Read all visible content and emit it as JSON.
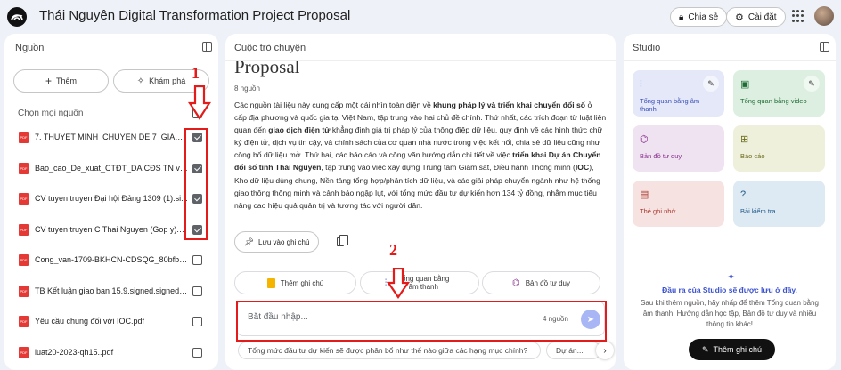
{
  "app": {
    "title": "Thái Nguyên Digital Transformation Project Proposal",
    "share_label": "Chia sẻ",
    "settings_label": "Cài đặt"
  },
  "sources": {
    "title": "Nguồn",
    "add_label": "Thêm",
    "explore_label": "Khám phá",
    "select_all_label": "Chọn mọi nguồn",
    "items": [
      {
        "name": "7. THUYET MINH_CHUYEN DE 7_GIAO DIC...",
        "checked": true
      },
      {
        "name": "Bao_cao_De_xuat_CTĐT_DA CĐS TN v0.1...",
        "checked": true
      },
      {
        "name": "CV tuyen truyen Đại hội Đảng 1309 (1).si...",
        "checked": true
      },
      {
        "name": "CV tuyen truyen C Thai Nguyen (Gop y).p...",
        "checked": true
      },
      {
        "name": "Cong_van-1709-BKHCN-CDSQG_80bfb....",
        "checked": false
      },
      {
        "name": "TB Kết luận giao ban 15.9.signed.signed....",
        "checked": false
      },
      {
        "name": "Yêu cầu chung đối với IOC.pdf",
        "checked": false
      },
      {
        "name": "luat20-2023-qh15..pdf",
        "checked": false
      }
    ],
    "pdf_tag": "PDF"
  },
  "chat": {
    "title": "Cuộc trò chuyện",
    "doc_heading": "Proposal",
    "source_count": "8 nguồn",
    "summary_parts": [
      "Các nguồn tài liệu này cung cấp một cái nhìn toàn diện về ",
      "khung pháp lý và triển khai chuyển đổi số",
      " ở cấp địa phương và quốc gia tại Việt Nam, tập trung vào hai chủ đề chính. Thứ nhất, các trích đoạn từ luật liên quan đến ",
      "giao dịch điện tử",
      " khẳng định giá trị pháp lý của thông điệp dữ liệu, quy định về các hình thức chữ ký điện tử, dịch vụ tin cậy, và chính sách của cơ quan nhà nước trong việc kết nối, chia sẻ dữ liệu cũng như công bố dữ liệu mở. Thứ hai, các báo cáo và công văn hướng dẫn chi tiết về việc ",
      "triển khai Dự án Chuyển đổi số tỉnh Thái Nguyên",
      ", tập trung vào việc xây dựng Trung tâm Giám sát, Điều hành Thông minh (",
      "IOC",
      "), Kho dữ liệu dùng chung, Nền tảng tổng hợp/phân tích dữ liệu, và các giải pháp chuyển ngành như hệ thống giao thông thông minh và cảnh báo ngập lụt, với tổng mức đầu tư dự kiến hơn 134 tỷ đồng, nhằm mục tiêu nâng cao hiệu quả quản trị và tương tác với người dân."
    ],
    "save_note_label": "Lưu vào ghi chú",
    "chips": [
      "Thêm ghi chú",
      "Tổng quan bằng âm thanh",
      "Bản đồ tư duy"
    ],
    "input_placeholder": "Bắt đầu nhập...",
    "input_source_count": "4 nguồn",
    "suggestions": [
      "Tổng mức đầu tư dự kiến sẽ được phân bổ như thế nào giữa các hạng mục chính?",
      "Dự án..."
    ]
  },
  "studio": {
    "title": "Studio",
    "tiles": [
      {
        "label": "Tổng quan bằng âm thanh",
        "icon": "audio-wave-icon",
        "bg": "#e4e8f8",
        "fg": "#3a4fb7"
      },
      {
        "label": "Tổng quan bằng video",
        "icon": "video-icon",
        "bg": "#dcefe0",
        "fg": "#1e6b34"
      },
      {
        "label": "Bản đồ tư duy",
        "icon": "mindmap-icon",
        "bg": "#efe3f1",
        "fg": "#8a2f8e"
      },
      {
        "label": "Báo cáo",
        "icon": "report-icon",
        "bg": "#eef0dc",
        "fg": "#6a6b1a"
      },
      {
        "label": "Thẻ ghi nhớ",
        "icon": "flashcard-icon",
        "bg": "#f6e3e1",
        "fg": "#a8352c"
      },
      {
        "label": "Bài kiểm tra",
        "icon": "quiz-icon",
        "bg": "#dde9f3",
        "fg": "#235b88"
      }
    ],
    "empty_title": "Đầu ra của Studio sẽ được lưu ở đây.",
    "empty_desc": "Sau khi thêm nguồn, hãy nhấp để thêm Tổng quan bằng âm thanh, Hướng dẫn học tập, Bản đồ tư duy và nhiều thông tin khác!",
    "add_note_label": "Thêm ghi chú"
  },
  "annotations": {
    "marker_1": "1",
    "marker_2": "2",
    "color": "#e31b1b"
  }
}
